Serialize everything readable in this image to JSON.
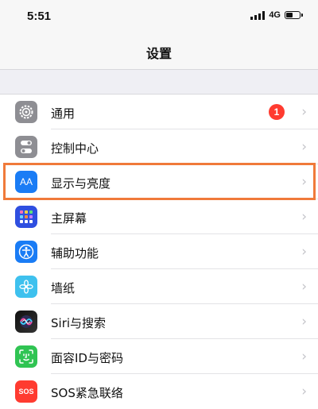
{
  "status_bar": {
    "time": "5:51",
    "network": "4G",
    "battery_level": 0.6
  },
  "nav": {
    "title": "设置"
  },
  "settings": {
    "items": [
      {
        "label": "通用",
        "icon": "gear-icon",
        "badge": "1"
      },
      {
        "label": "控制中心",
        "icon": "toggle-switches-icon"
      },
      {
        "label": "显示与亮度",
        "icon": "display-aa-icon",
        "icon_text": "AA",
        "highlighted": true
      },
      {
        "label": "主屏幕",
        "icon": "home-grid-icon"
      },
      {
        "label": "辅助功能",
        "icon": "accessibility-icon"
      },
      {
        "label": "墙纸",
        "icon": "flower-icon"
      },
      {
        "label": "Siri与搜索",
        "icon": "siri-icon"
      },
      {
        "label": "面容ID与密码",
        "icon": "face-id-icon"
      },
      {
        "label": "SOS紧急联络",
        "icon": "sos-icon",
        "icon_text": "SOS"
      }
    ],
    "chevron": "›"
  },
  "colors": {
    "highlight": "#f07a3a",
    "badge": "#ff3b30",
    "background": "#efeff4"
  }
}
